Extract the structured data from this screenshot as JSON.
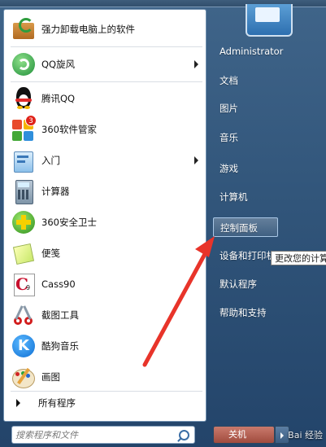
{
  "desktop": {
    "caption": "强力卸载电脑上的软件"
  },
  "programs": [
    {
      "label": "强力卸载电脑上的软件",
      "icon": "uninstall-box-icon",
      "submenu": false
    },
    {
      "label": "QQ旋风",
      "icon": "qq-whirlwind-icon",
      "submenu": true
    },
    {
      "label": "腾讯QQ",
      "icon": "qq-penguin-icon",
      "submenu": false
    },
    {
      "label": "360软件管家",
      "icon": "360-software-manager-icon",
      "badge": "3",
      "submenu": false
    },
    {
      "label": "入门",
      "icon": "getting-started-icon",
      "submenu": true
    },
    {
      "label": "计算器",
      "icon": "calculator-icon",
      "submenu": false
    },
    {
      "label": "360安全卫士",
      "icon": "360-security-guard-icon",
      "submenu": false
    },
    {
      "label": "便笺",
      "icon": "sticky-notes-icon",
      "submenu": false
    },
    {
      "label": "Cass90",
      "icon": "cass90-icon",
      "submenu": false
    },
    {
      "label": "截图工具",
      "icon": "snipping-tool-icon",
      "submenu": false
    },
    {
      "label": "酷狗音乐",
      "icon": "kugou-music-icon",
      "submenu": false
    },
    {
      "label": "画图",
      "icon": "paint-icon",
      "submenu": false
    }
  ],
  "all_programs": "所有程序",
  "search": {
    "placeholder": "搜索程序和文件"
  },
  "right_pane": {
    "user": "Administrator",
    "documents": "文档",
    "pictures": "图片",
    "music": "音乐",
    "games": "游戏",
    "computer": "计算机",
    "control_panel": "控制面板",
    "devices_printers": "设备和打印机",
    "default_programs": "默认程序",
    "help_support": "帮助和支持"
  },
  "tooltip": "更改您的计算",
  "shutdown": "关机",
  "watermark": "Bai 经验"
}
